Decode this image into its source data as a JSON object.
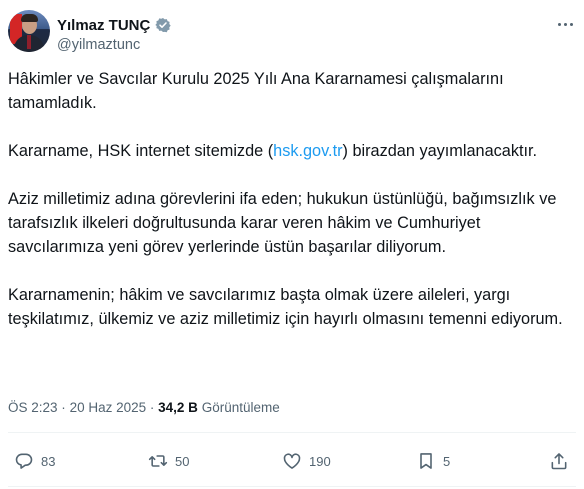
{
  "author": {
    "name": "Yılmaz TUNÇ",
    "handle": "@yilmaztunc"
  },
  "tweet": {
    "paragraphs": [
      {
        "text": "Hâkimler ve Savcılar Kurulu 2025 Yılı Ana Kararnamesi çalışmalarını tamamladık."
      },
      {
        "text_before": "Kararname, HSK internet sitemizde (",
        "link": "hsk.gov.tr",
        "text_after": ") birazdan yayımlanacaktır."
      },
      {
        "text": "Aziz milletimiz adına görevlerini ifa eden; hukukun üstünlüğü, bağımsızlık ve tarafsızlık ilkeleri doğrultusunda karar veren hâkim ve Cumhuriyet savcılarımıza yeni görev yerlerinde üstün başarılar diliyorum."
      },
      {
        "text": "Kararnamenin; hâkim ve savcılarımız başta olmak üzere aileleri, yargı teşkilatımız, ülkemiz ve aziz milletimiz için hayırlı olmasını temenni ediyorum."
      }
    ]
  },
  "meta": {
    "time": "ÖS 2:23",
    "separator": "·",
    "date": "20 Haz 2025",
    "views_count": "34,2 B",
    "views_label": "Görüntüleme"
  },
  "actions": {
    "replies": "83",
    "reposts": "50",
    "likes": "190",
    "bookmarks": "5"
  },
  "colors": {
    "link": "#1d9bf0",
    "secondary_text": "#536471",
    "verified": "#829aab"
  },
  "icons": [
    "verified-badge-icon",
    "more-icon",
    "reply-icon",
    "repost-icon",
    "like-icon",
    "bookmark-icon",
    "share-icon"
  ]
}
